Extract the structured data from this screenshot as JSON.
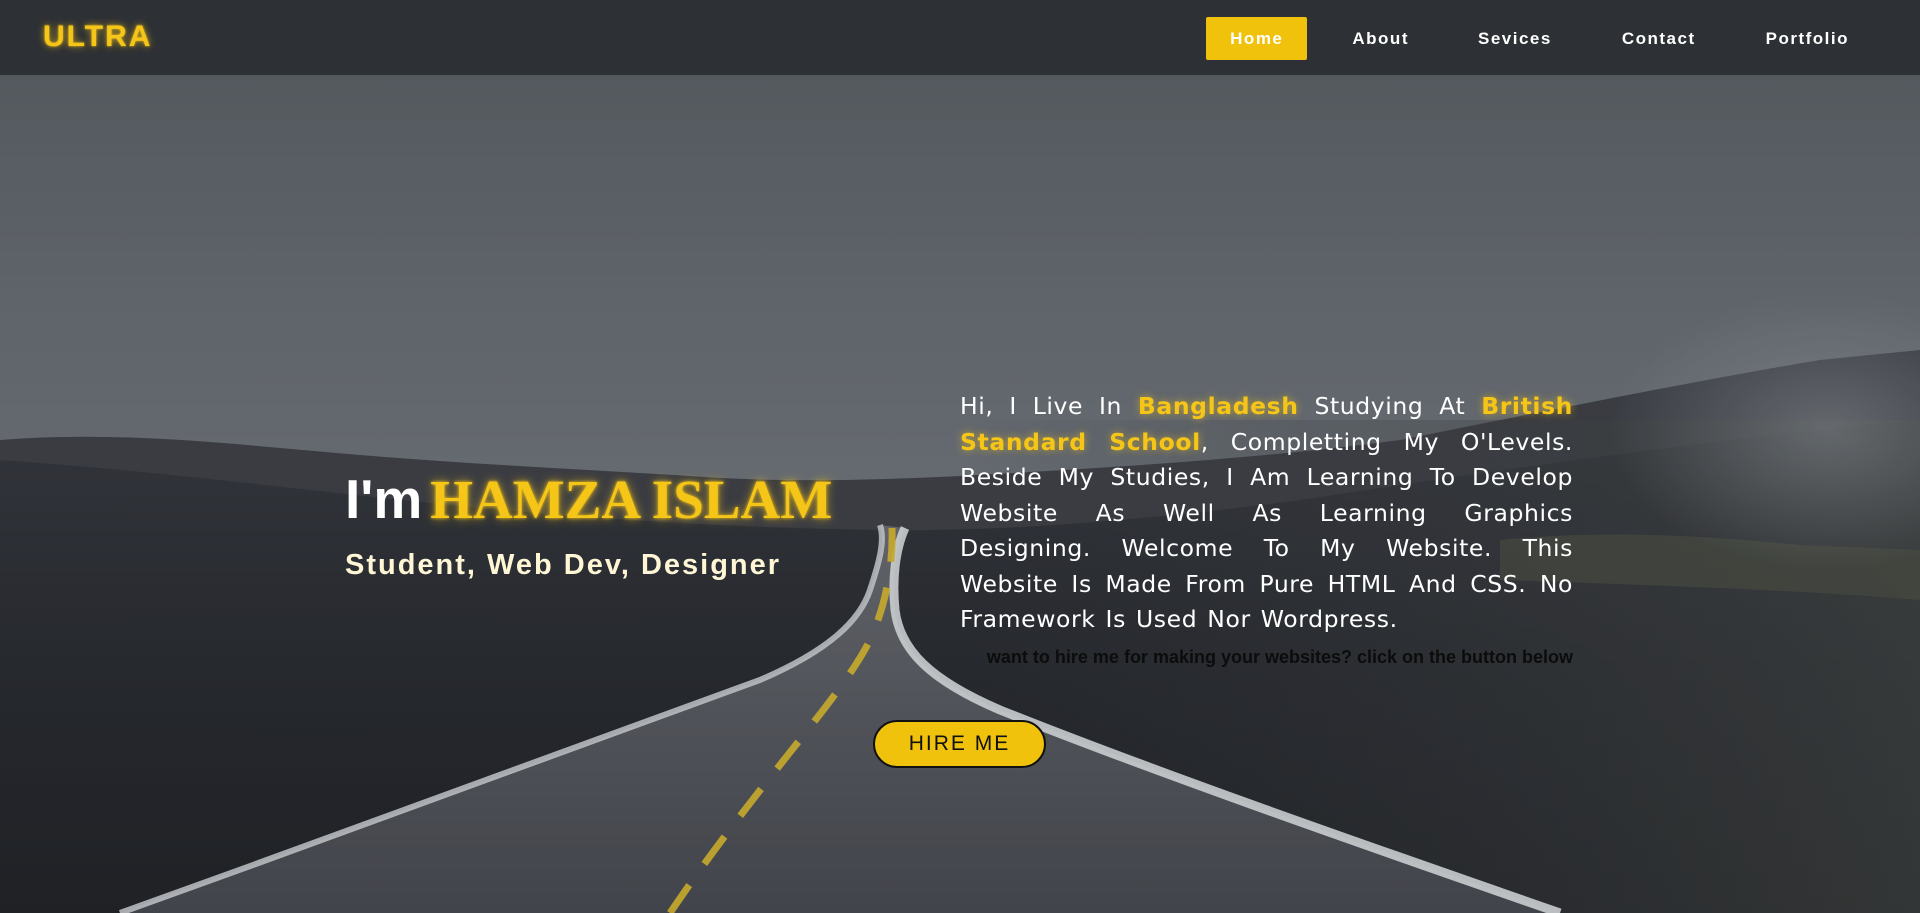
{
  "navbar": {
    "logo": "ULTRA",
    "links": [
      {
        "label": "Home",
        "active": true
      },
      {
        "label": "About",
        "active": false
      },
      {
        "label": "Sevices",
        "active": false
      },
      {
        "label": "Contact",
        "active": false
      },
      {
        "label": "Portfolio",
        "active": false
      }
    ]
  },
  "hero": {
    "greeting_prefix": "I'm",
    "name": "HAMZA ISLAM",
    "roles": "Student, Web Dev, Designer"
  },
  "bio": {
    "part1": "Hi, I Live In ",
    "country": "Bangladesh",
    "part2": " Studying At ",
    "school": "British Standard School",
    "part3": ", Completting My O'Levels. Beside My Studies, I Am Learning To Develop Website As Well As Learning Graphics Designing. Welcome To My Website. This Website Is Made From Pure HTML And CSS. No Framework Is Used Nor Wordpress."
  },
  "hire": {
    "prompt": "want to hire me for making your websites? click on the button below",
    "button_label": "HIRE ME"
  },
  "colors": {
    "accent": "#f0c20c",
    "navbar_bg": "#2d3035",
    "text_light": "#ffffff"
  }
}
